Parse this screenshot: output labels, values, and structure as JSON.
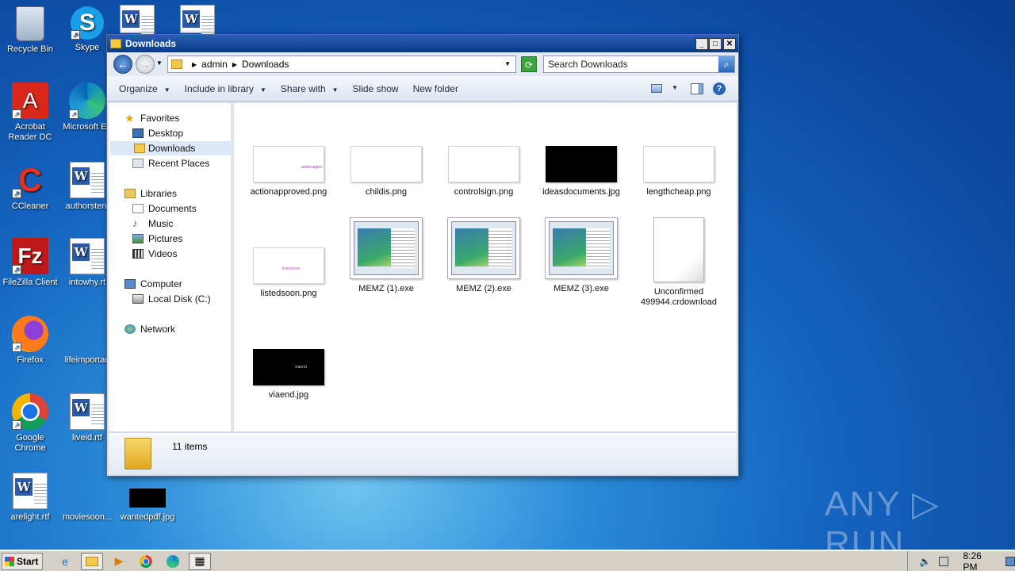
{
  "desktop": {
    "icons": [
      {
        "label": "Recycle Bin"
      },
      {
        "label": "Skype"
      },
      {
        "label": "Acrobat Reader DC"
      },
      {
        "label": "Microsoft Ed"
      },
      {
        "label": "CCleaner"
      },
      {
        "label": "authorsten."
      },
      {
        "label": "FileZilla Client"
      },
      {
        "label": "intowhy.rt"
      },
      {
        "label": "Firefox"
      },
      {
        "label": "lifeimportan"
      },
      {
        "label": "Google Chrome"
      },
      {
        "label": "liveid.rtf"
      },
      {
        "label": "arelight.rtf"
      },
      {
        "label": "moviesoon..."
      },
      {
        "label": "wantedpdf.jpg"
      }
    ],
    "watermark": "ANY ▷ RUN"
  },
  "window": {
    "title": "Downloads",
    "minimize": "_",
    "maximize": "□",
    "close": "✕",
    "breadcrumb": [
      "admin",
      "Downloads"
    ],
    "search_placeholder": "Search Downloads",
    "toolbar": {
      "organize": "Organize",
      "include": "Include in library",
      "share": "Share with",
      "slideshow": "Slide show",
      "newfolder": "New folder"
    },
    "nav": {
      "favorites": "Favorites",
      "desktop": "Desktop",
      "downloads": "Downloads",
      "recent": "Recent Places",
      "libraries": "Libraries",
      "documents": "Documents",
      "music": "Music",
      "pictures": "Pictures",
      "videos": "Videos",
      "computer": "Computer",
      "localdisk": "Local Disk (C:)",
      "network": "Network"
    },
    "files": [
      {
        "name": "actionapproved.png",
        "thumb_text": "actionappro"
      },
      {
        "name": "childis.png",
        "thumb_text": ""
      },
      {
        "name": "controlsign.png",
        "thumb_text": ""
      },
      {
        "name": "ideasdocuments.jpg",
        "thumb_text": ""
      },
      {
        "name": "lengthcheap.png",
        "thumb_text": ""
      },
      {
        "name": "listedsoon.png",
        "thumb_text": "listedsoon"
      },
      {
        "name": "MEMZ (1).exe"
      },
      {
        "name": "MEMZ (2).exe"
      },
      {
        "name": "MEMZ (3).exe"
      },
      {
        "name": "Unconfirmed 499944.crdownload"
      },
      {
        "name": "viaend.jpg",
        "thumb_text": "viaend"
      }
    ],
    "status": "11 items"
  },
  "taskbar": {
    "start": "Start",
    "clock": "8:26 PM"
  }
}
